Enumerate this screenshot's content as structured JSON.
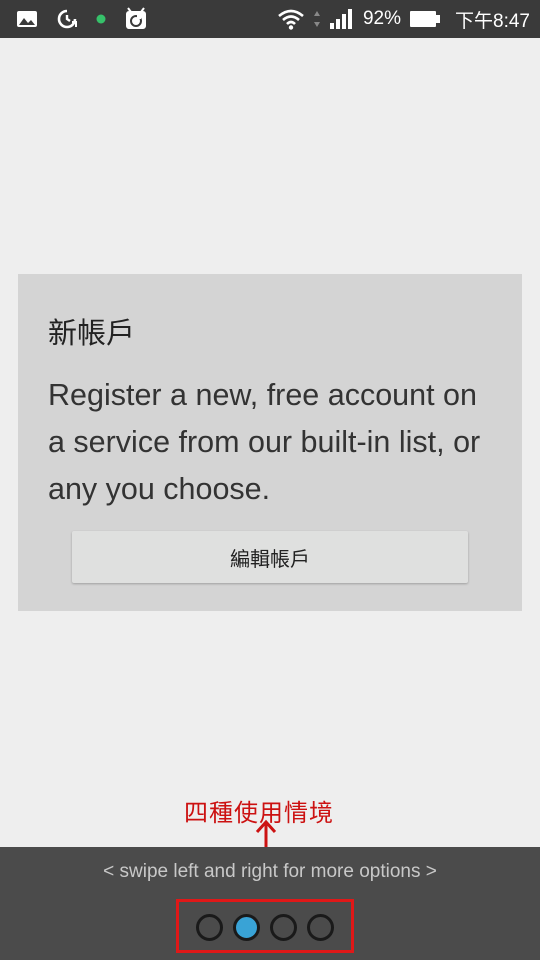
{
  "status_bar": {
    "battery_text": "92%",
    "time": "下午8:47",
    "icons": [
      "image-icon",
      "data-saver-icon",
      "notification-dot-icon",
      "f-droid-icon",
      "wifi-icon",
      "signal-icon",
      "battery-icon"
    ],
    "dot_color": "#36c16a"
  },
  "card": {
    "title": "新帳戶",
    "body": "Register a new, free account on a service from our built-in list, or any you choose.",
    "button_label": "編輯帳戶"
  },
  "annotation": {
    "text": "四種使用情境",
    "color": "#cc1111"
  },
  "pager": {
    "hint": "< swipe left and right for more options >",
    "page_count": 4,
    "active_index": 1,
    "active_color": "#39a3d6"
  }
}
